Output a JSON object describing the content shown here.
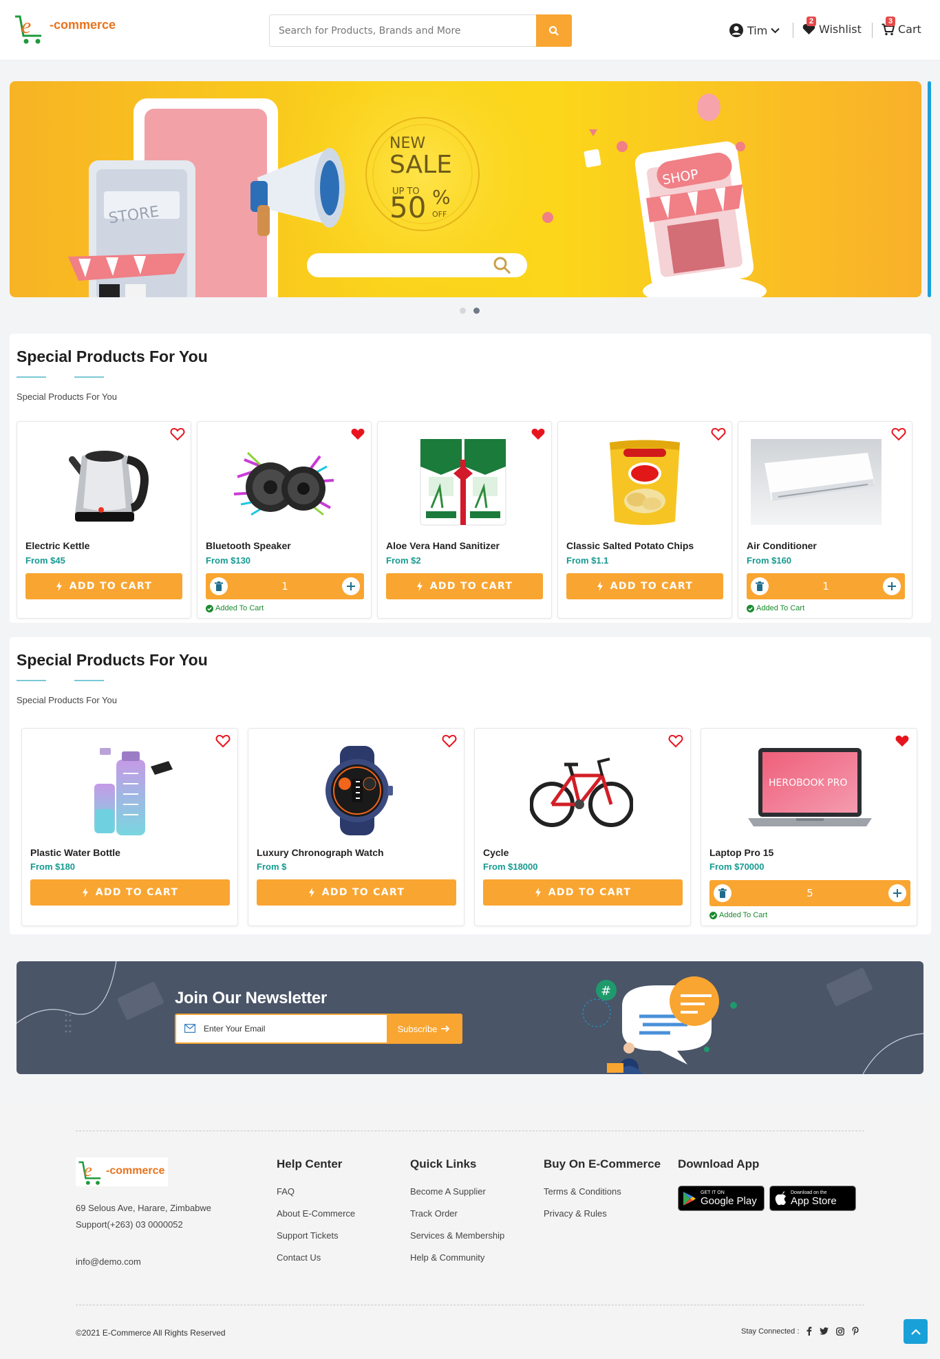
{
  "header": {
    "logo_text": "-commerce",
    "logo_letter": "e",
    "search_placeholder": "Search for Products, Brands and More",
    "user_name": "Tim",
    "wishlist_label": "Wishlist",
    "wishlist_count": "2",
    "cart_label": "Cart",
    "cart_count": "3"
  },
  "banner": {
    "text_new": "NEW",
    "text_sale": "SALE",
    "text_upto": "UP TO",
    "text_percent": "50",
    "text_pct_sign": "%",
    "text_off": "OFF",
    "store_sign": "STORE",
    "shop_sign": "SHOP",
    "slides_count": 2,
    "active_slide": 2
  },
  "section1": {
    "title": "Special Products For You",
    "subtitle": "Special Products For You",
    "products": [
      {
        "name": "Electric Kettle",
        "price": "From $45",
        "favorite": false,
        "in_cart": false,
        "action": "ADD TO CART"
      },
      {
        "name": "Bluetooth Speaker",
        "price": "From $130",
        "favorite": true,
        "in_cart": true,
        "qty": "1",
        "added": "Added To Cart"
      },
      {
        "name": "Aloe Vera Hand Sanitizer",
        "price": "From $2",
        "favorite": true,
        "in_cart": false,
        "action": "ADD TO CART"
      },
      {
        "name": "Classic Salted Potato Chips",
        "price": "From $1.1",
        "favorite": false,
        "in_cart": false,
        "action": "ADD TO CART"
      },
      {
        "name": "Air Conditioner",
        "price": "From $160",
        "favorite": false,
        "in_cart": true,
        "qty": "1",
        "added": "Added To Cart"
      }
    ]
  },
  "section2": {
    "title": "Special Products For You",
    "subtitle": "Special Products For You",
    "products": [
      {
        "name": "Plastic Water Bottle",
        "price": "From $180",
        "favorite": false,
        "in_cart": false,
        "action": "ADD TO CART"
      },
      {
        "name": "Luxury Chronograph Watch",
        "price": "From $",
        "favorite": false,
        "in_cart": false,
        "action": "ADD TO CART"
      },
      {
        "name": "Cycle",
        "price": "From $18000",
        "favorite": false,
        "in_cart": false,
        "action": "ADD TO CART"
      },
      {
        "name": "Laptop Pro 15",
        "price": "From $70000",
        "favorite": true,
        "in_cart": true,
        "qty": "5",
        "added": "Added To Cart",
        "screen_text": "HEROBOOK PRO"
      }
    ]
  },
  "newsletter": {
    "title": "Join Our Newsletter",
    "email_placeholder": "Enter Your Email",
    "subscribe_label": "Subscribe"
  },
  "footer": {
    "address": "69 Selous Ave, Harare, Zimbabwe",
    "support": "Support(+263) 03 0000052",
    "email": "info@demo.com",
    "help_center": {
      "title": "Help Center",
      "links": [
        "FAQ",
        "About E-Commerce",
        "Support Tickets",
        "Contact Us"
      ]
    },
    "quick_links": {
      "title": "Quick Links",
      "links": [
        "Become A Supplier",
        "Track Order",
        "Services & Membership",
        "Help & Community"
      ]
    },
    "buy_on": {
      "title": "Buy On E-Commerce",
      "links": [
        "Terms & Conditions",
        "Privacy & Rules"
      ]
    },
    "download": {
      "title": "Download App",
      "google_small": "GET IT ON",
      "google_large": "Google Play",
      "apple_small": "Download on the",
      "apple_large": "App Store"
    },
    "copyright": "©2021 E-Commerce All Rights Reserved",
    "stay_connected": "Stay Connected :"
  },
  "colors": {
    "accent": "#f9a531",
    "teal": "#159a91",
    "favorite": "#e8141d",
    "newsletter_bg": "#4a5568"
  }
}
